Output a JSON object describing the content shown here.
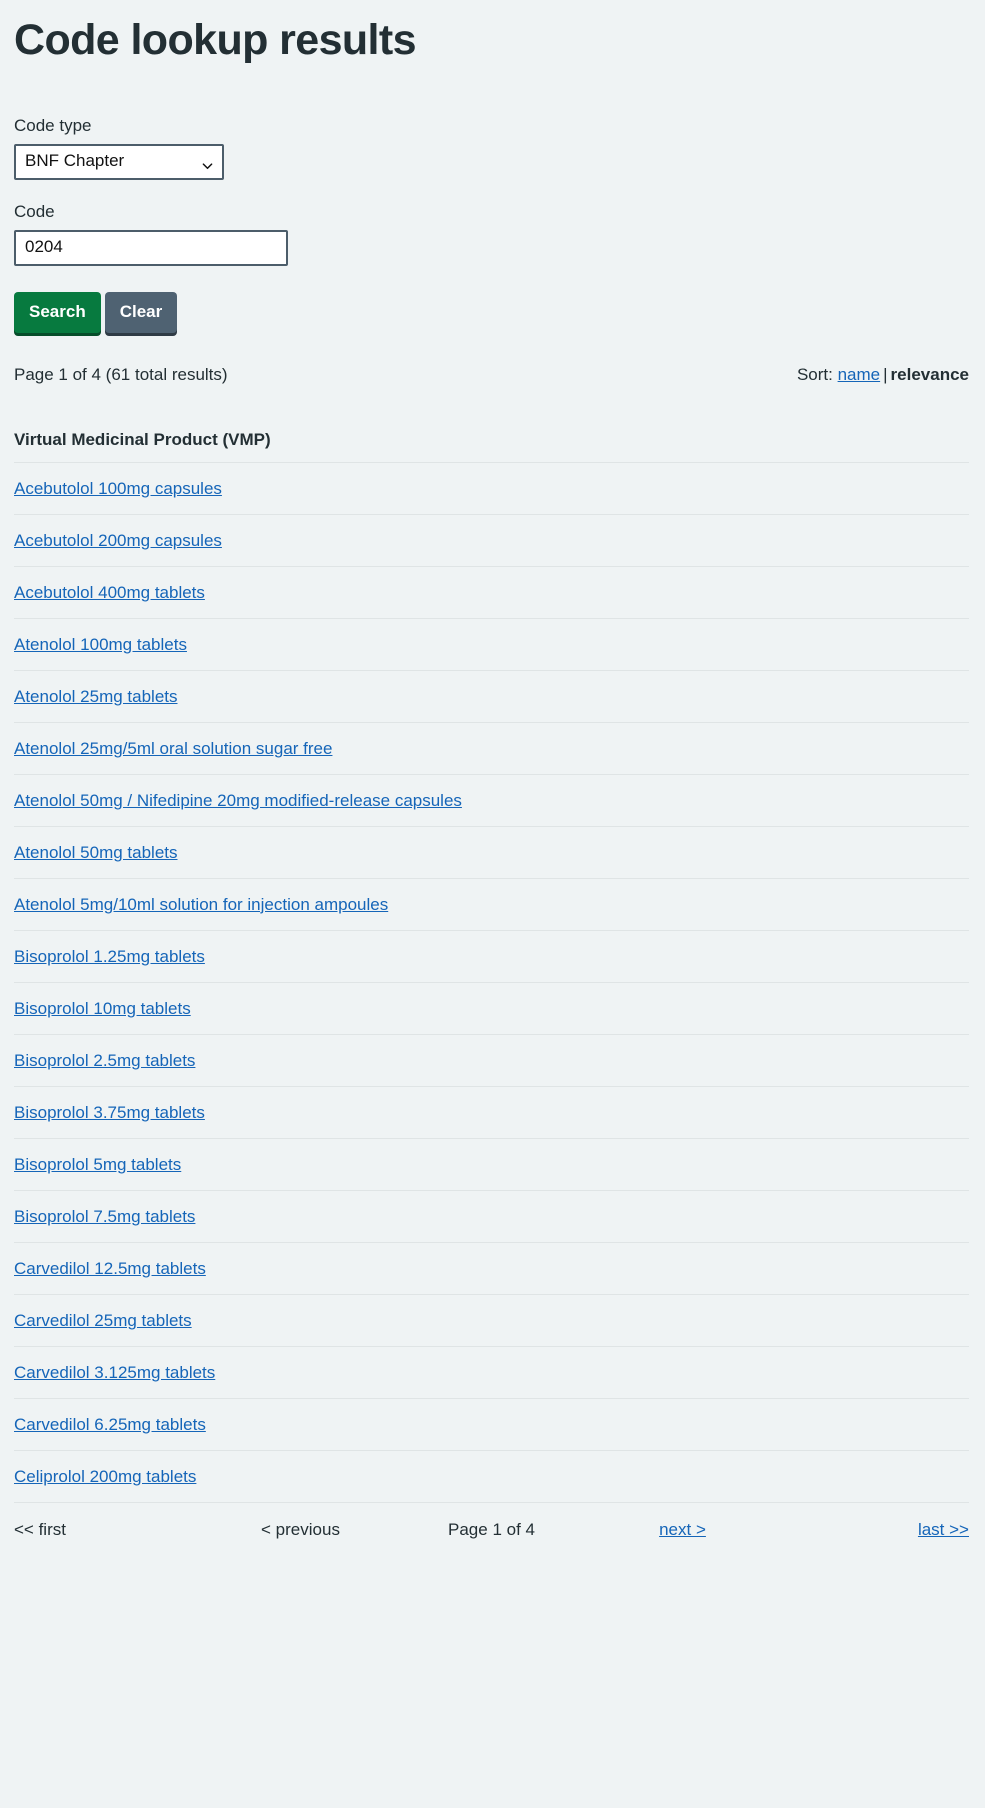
{
  "page_title": "Code lookup results",
  "form": {
    "code_type_label": "Code type",
    "code_type_value": "BNF Chapter",
    "code_type_options": [
      "BNF Chapter"
    ],
    "code_label": "Code",
    "code_value": "0204",
    "code_placeholder": "",
    "search_label": "Search",
    "clear_label": "Clear",
    "search_color": "#077a3f",
    "clear_color": "#4f6272"
  },
  "meta": {
    "result_summary": "Page 1 of 4 (61 total results)",
    "sort_label": "Sort:",
    "sort_name": "name",
    "sort_separator": "|",
    "sort_relevance": "relevance"
  },
  "results": {
    "section_title": "Virtual Medicinal Product (VMP)",
    "items": [
      "Acebutolol 100mg capsules",
      "Acebutolol 200mg capsules",
      "Acebutolol 400mg tablets",
      "Atenolol 100mg tablets",
      "Atenolol 25mg tablets",
      "Atenolol 25mg/5ml oral solution sugar free",
      "Atenolol 50mg / Nifedipine 20mg modified-release capsules",
      "Atenolol 50mg tablets",
      "Atenolol 5mg/10ml solution for injection ampoules",
      "Bisoprolol 1.25mg tablets",
      "Bisoprolol 10mg tablets",
      "Bisoprolol 2.5mg tablets",
      "Bisoprolol 3.75mg tablets",
      "Bisoprolol 5mg tablets",
      "Bisoprolol 7.5mg tablets",
      "Carvedilol 12.5mg tablets",
      "Carvedilol 25mg tablets",
      "Carvedilol 3.125mg tablets",
      "Carvedilol 6.25mg tablets",
      "Celiprolol 200mg tablets"
    ]
  },
  "pagination": {
    "first": "<< first",
    "previous": "< previous",
    "status": "Page 1 of 4",
    "next": "next >",
    "last": "last >>"
  },
  "colors": {
    "background": "#eff3f4",
    "link": "#1565b8",
    "text": "#232f34",
    "rule": "#dfe4e5"
  }
}
